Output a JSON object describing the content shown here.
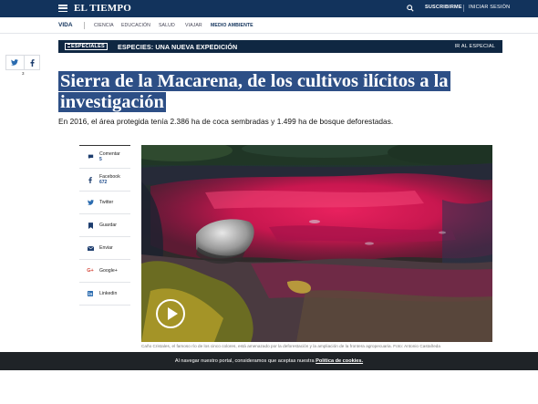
{
  "header": {
    "logo": "EL TIEMPO",
    "subscribe_label": "SUSCRIBIRME",
    "login_label": "INICIAR SESIÓN"
  },
  "section_nav": {
    "section": "VIDA",
    "items": [
      "CIENCIA",
      "EDUCACIÓN",
      "SALUD",
      "VIAJAR",
      "MEDIO AMBIENTE"
    ],
    "active": "MEDIO AMBIENTE"
  },
  "special_banner": {
    "badge": "ESPECIALES",
    "title": "ESPECIES: UNA NUEVA EXPEDICIÓN",
    "link": "IR AL ESPECIAL"
  },
  "share_top": {
    "count": "3"
  },
  "article": {
    "title_line1": "Sierra de la Macarena, de los cultivos ilícitos a la",
    "title_line2": "investigación",
    "subtitle": "En 2016, el área protegida tenía 2.386 ha de coca sembradas y 1.499 ha de bosque deforestadas.",
    "caption": "Caño Cristales, el famoso río de los cinco colores, está amenazado por la deforestación y la ampliación de la frontera agropecuaria. Foto: Antonio Castañeda"
  },
  "side_actions": [
    {
      "label": "Comentar",
      "count": "5",
      "icon": "comment-icon"
    },
    {
      "label": "Facebook",
      "count": "672",
      "icon": "facebook-icon"
    },
    {
      "label": "Twitter",
      "count": "",
      "icon": "twitter-icon"
    },
    {
      "label": "Guardar",
      "count": "",
      "icon": "bookmark-icon"
    },
    {
      "label": "Enviar",
      "count": "",
      "icon": "mail-icon"
    },
    {
      "label": "Google+",
      "count": "",
      "icon": "google-plus-icon"
    },
    {
      "label": "Linkedin",
      "count": "",
      "icon": "linkedin-icon"
    }
  ],
  "cookie_bar": {
    "text": "Al navegar nuestro portal, consideramos que aceptas nuestra",
    "link": "Política de cookies."
  },
  "colors": {
    "navy": "#12335c",
    "headline_highlight": "#2d4f86",
    "cookie_bg": "#1f2327"
  }
}
